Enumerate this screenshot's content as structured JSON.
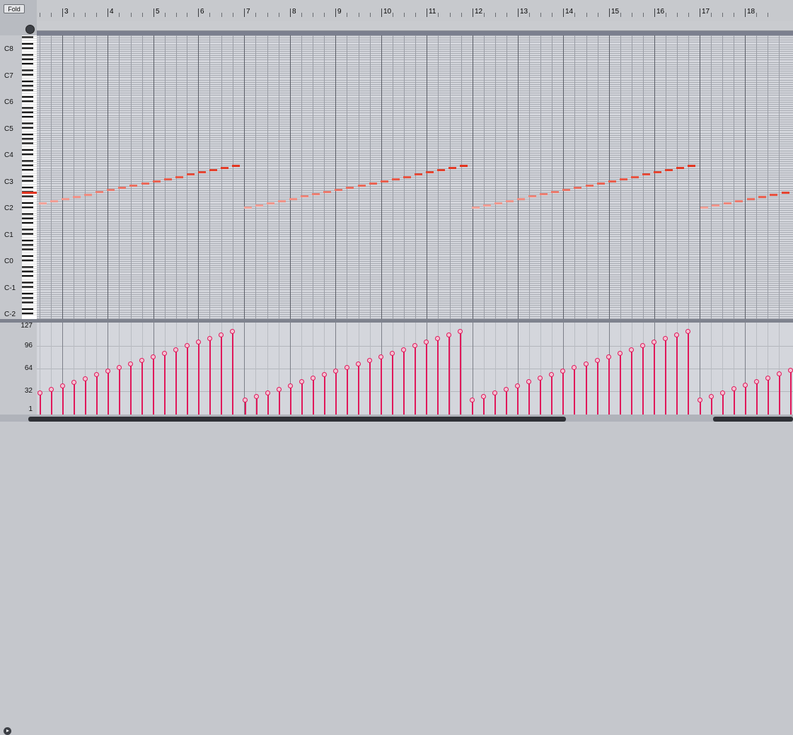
{
  "header": {
    "fold_label": "Fold",
    "preview_icon": "headphones-icon",
    "bar_numbers": [
      "3",
      "4",
      "5",
      "6",
      "7",
      "8",
      "9",
      "10",
      "11",
      "12",
      "13",
      "14",
      "15",
      "16",
      "17",
      "18"
    ]
  },
  "pitch_labels": [
    "C8",
    "C7",
    "C6",
    "C5",
    "C4",
    "C3",
    "C2",
    "C1",
    "C0",
    "C-1",
    "C-2"
  ],
  "velocity_labels": [
    "127",
    "96",
    "64",
    "32",
    "1"
  ],
  "colors": {
    "grid_bg": "#d4d6dc",
    "note_low": "#f2a39a",
    "note_high": "#e2341f",
    "velocity_stem": "#e0185a",
    "loop_band": "#7b7f8e"
  },
  "velocity_toggle_icon": "play-triangle-icon"
}
